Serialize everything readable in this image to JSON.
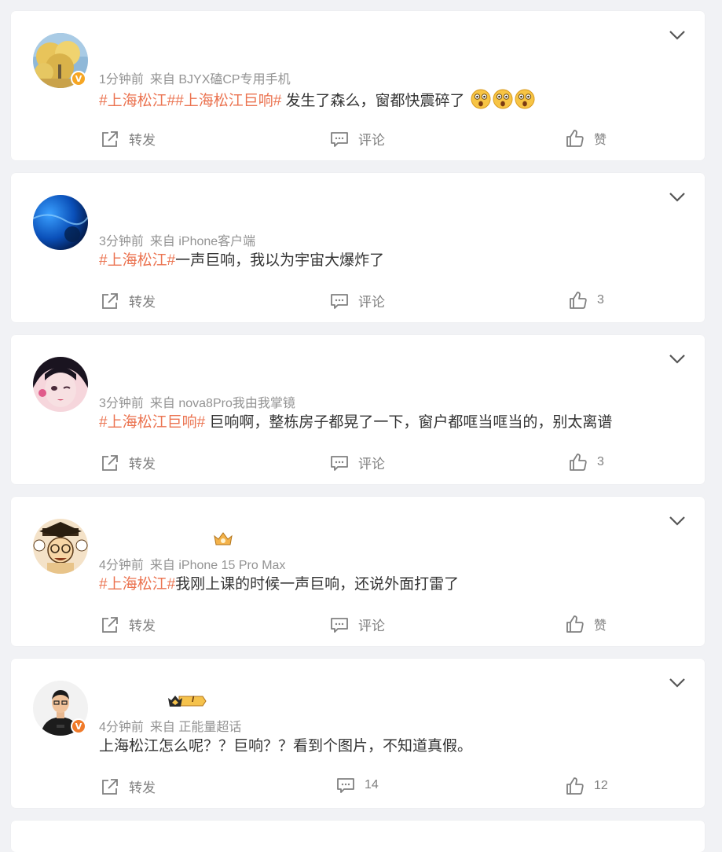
{
  "colors": {
    "accent": "#eb7350",
    "text": "#333333",
    "meta": "#939393",
    "action": "#808080",
    "background": "#f1f2f5"
  },
  "posts": [
    {
      "time": "1分钟前",
      "source": "来自 BJYX磕CP专用手机",
      "tags": [
        "#上海松江#",
        "#上海松江巨响#"
      ],
      "text": " 发生了森么，窗都快震碎了",
      "emoji_count": 3,
      "repost_label": "转发",
      "comment_label": "评论",
      "like_label": "赞",
      "verified": true,
      "avatar_icon": "autumn-tree-avatar"
    },
    {
      "time": "3分钟前",
      "source": "来自 iPhone客户端",
      "tags": [
        "#上海松江#"
      ],
      "text": "一声巨响，我以为宇宙大爆炸了",
      "repost_label": "转发",
      "comment_label": "评论",
      "like_label": "3",
      "avatar_icon": "blue-water-avatar"
    },
    {
      "time": "3分钟前",
      "source": "来自 nova8Pro我由我掌镜",
      "tags": [
        "#上海松江巨响#"
      ],
      "text": " 巨响啊，整栋房子都晃了一下，窗户都哐当哐当的，别太离谱",
      "repost_label": "转发",
      "comment_label": "评论",
      "like_label": "3",
      "avatar_icon": "anime-girl-avatar"
    },
    {
      "time": "4分钟前",
      "source": "来自 iPhone 15 Pro Max",
      "tags": [
        "#上海松江#"
      ],
      "text": "我刚上课的时候一声巨响，还说外面打雷了",
      "repost_label": "转发",
      "comment_label": "评论",
      "like_label": "赞",
      "avatar_icon": "cartoon-scholar-avatar",
      "badge_icon": "member-crown-icon"
    },
    {
      "time": "4分钟前",
      "source": "来自 正能量超话",
      "tags": [],
      "text": "上海松江怎么呢？？巨响？？看到个图片，不知道真假。",
      "repost_label": "转发",
      "comment_label": "14",
      "like_label": "12",
      "verified": true,
      "avatar_icon": "man-photo-avatar",
      "badge_icon": "level-crown-badge",
      "badge_text": "I"
    }
  ]
}
